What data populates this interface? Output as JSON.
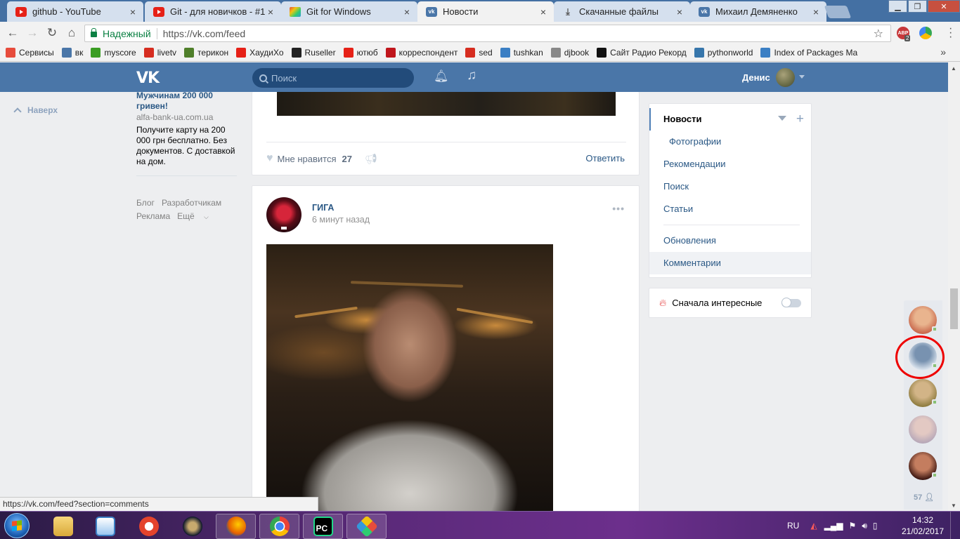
{
  "browser": {
    "tabs": [
      {
        "title": "github - YouTube",
        "icon": "youtube-icon"
      },
      {
        "title": "Git - для новичков - #1",
        "icon": "youtube-icon"
      },
      {
        "title": "Git for Windows",
        "icon": "git-icon"
      },
      {
        "title": "Новости",
        "icon": "vk-icon",
        "active": true
      },
      {
        "title": "Скачанные файлы",
        "icon": "download-icon"
      },
      {
        "title": "Михаил Демяненко",
        "icon": "vk-icon"
      }
    ],
    "close_glyph": "×",
    "secure_label": "Надежный",
    "url": "https://vk.com/feed",
    "extension_badge": "2",
    "bookmarks": [
      {
        "label": "Сервисы",
        "color": "#e74c3c"
      },
      {
        "label": "вк",
        "color": "#4a76a8"
      },
      {
        "label": "myscore",
        "color": "#3a9d23"
      },
      {
        "label": "livetv",
        "color": "#d62d20"
      },
      {
        "label": "терикон",
        "color": "#4f7f2a"
      },
      {
        "label": "ХаудиХо",
        "color": "#e62117"
      },
      {
        "label": "Ruseller",
        "color": "#222222"
      },
      {
        "label": "ютюб",
        "color": "#e62117"
      },
      {
        "label": "корреспондент",
        "color": "#c0161c"
      },
      {
        "label": "sed",
        "color": "#d62d20"
      },
      {
        "label": "tushkan",
        "color": "#3b7fc4"
      },
      {
        "label": "djbook",
        "color": "#888888"
      },
      {
        "label": "Сайт Радио Рекорд",
        "color": "#111111"
      },
      {
        "label": "pythonworld",
        "color": "#3776ab"
      },
      {
        "label": "Index of Packages Ma",
        "color": "#3b7fc4"
      }
    ],
    "status_url": "https://vk.com/feed?section=comments"
  },
  "vk": {
    "logo": "VK",
    "search_placeholder": "Поиск",
    "user_name": "Денис"
  },
  "left": {
    "up_label": "Наверх",
    "ad": {
      "title": "Мужчинам 200 000 гривен!",
      "domain": "alfa-bank-ua.com.ua",
      "text": "Получите карту на 200 000 грн бесплатно. Без документов. С доставкой на дом."
    },
    "footer": [
      "Блог",
      "Разработчикам",
      "Реклама",
      "Ещё"
    ]
  },
  "feed": {
    "prev_post": {
      "like_label": "Мне нравится",
      "like_count": "27",
      "reply_label": "Ответить"
    },
    "post": {
      "author": "ГИГА",
      "time": "6 минут назад"
    }
  },
  "right_menu": {
    "items": [
      "Новости",
      "Фотографии",
      "Рекомендации",
      "Поиск",
      "Статьи"
    ],
    "items2": [
      "Обновления",
      "Комментарии"
    ],
    "interesting_label": "Сначала интересные"
  },
  "chat": {
    "friends": [
      {
        "name": "friend-1",
        "colors": [
          "#c7654a",
          "#e9b48e"
        ],
        "online": true
      },
      {
        "name": "friend-2",
        "colors": [
          "#dfe7f0",
          "#7892b0"
        ],
        "online": true,
        "highlighted": true
      },
      {
        "name": "friend-3",
        "colors": [
          "#8d7b3e",
          "#d2b487"
        ],
        "online": true
      },
      {
        "name": "friend-4",
        "colors": [
          "#b6a7b8",
          "#e3c9c3"
        ],
        "online": false
      },
      {
        "name": "friend-5",
        "colors": [
          "#3a1510",
          "#c47d5f"
        ],
        "online": true
      }
    ],
    "online_count": "57"
  },
  "taskbar": {
    "language": "RU",
    "time": "14:32",
    "date": "21/02/2017"
  }
}
